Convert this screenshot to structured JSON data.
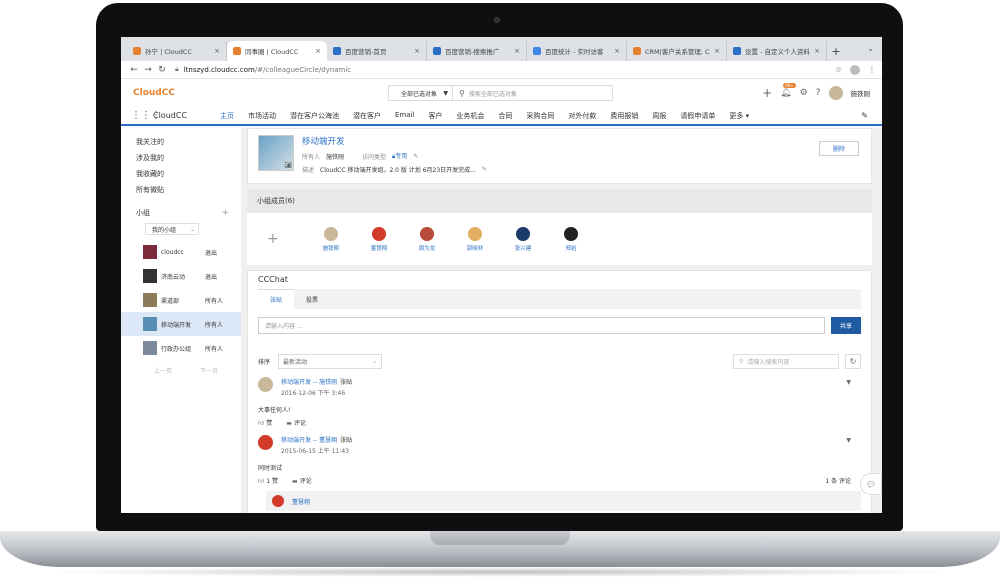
{
  "browser": {
    "tabs": [
      {
        "title": "孙宁 | CloudCC",
        "icon": "cloudcc-icon",
        "color": "#e8812f"
      },
      {
        "title": "同事圈 | CloudCC",
        "icon": "cloudcc-icon",
        "color": "#e8812f",
        "active": true
      },
      {
        "title": "百度营销-首页",
        "icon": "baidu-icon",
        "color": "#2b6fc4"
      },
      {
        "title": "百度营销-搜索推广",
        "icon": "baidu-icon",
        "color": "#2b6fc4"
      },
      {
        "title": "百度统计 - 实时访客",
        "icon": "baidu-stats-icon",
        "color": "#3f87e6"
      },
      {
        "title": "CRM|客户关系管理, C",
        "icon": "cloudcc-icon",
        "color": "#e8812f"
      },
      {
        "title": "设置 - 自定义个人资料",
        "icon": "gear-icon",
        "color": "#2b6fc4"
      }
    ],
    "url_host": "ltnszyd.cloudcc.com",
    "url_path": "/#/colleagueCircle/dynamic"
  },
  "header": {
    "logo": "CloudCC",
    "scope_select": "全部已选对象",
    "search_placeholder": "搜索全部已选对象",
    "notify_badge": "99+",
    "user_name": "施铁刚"
  },
  "nav": {
    "app_name": "CloudCC",
    "items": [
      "主页",
      "市场活动",
      "潜在客户公海池",
      "潜在客户",
      "Email",
      "客户",
      "业务机会",
      "合同",
      "采购合同",
      "对外付款",
      "费用报销",
      "周报",
      "请假申请单",
      "更多"
    ]
  },
  "sidebar": {
    "links": [
      "我关注的",
      "涉及我的",
      "我收藏的",
      "所有微贴"
    ],
    "groups_title": "小组",
    "my_groups": "我的小组",
    "groups": [
      {
        "name": "cloudcc",
        "action": "退出",
        "color": "#7a2a3a"
      },
      {
        "name": "济南云动",
        "action": "退出",
        "color": "#333333"
      },
      {
        "name": "渠道部",
        "action": "所有人",
        "color": "#8a7a5a"
      },
      {
        "name": "移动端开发",
        "action": "所有人",
        "color": "#5a8fb5"
      },
      {
        "name": "行政办公组",
        "action": "所有人",
        "color": "#7a8a9a"
      }
    ],
    "prev": "上一页",
    "next": "下一页"
  },
  "group": {
    "title": "移动端开发",
    "owner_label": "所有人",
    "owner": "施铁刚",
    "access_label": "访问类型",
    "access": "专用",
    "desc_label": "描述",
    "desc": "CloudCC 移动端开发组。2.0 版 计划 6月23日开发完成...",
    "delete": "删除"
  },
  "members": {
    "title": "小组成员(6)",
    "list": [
      {
        "name": "施铁刚",
        "color": "#c9b89a"
      },
      {
        "name": "董慧翔",
        "color": "#d23a2a"
      },
      {
        "name": "周为龙",
        "color": "#b84a3a"
      },
      {
        "name": "郭晓非",
        "color": "#e0b060"
      },
      {
        "name": "张兴建",
        "color": "#1a3a6a"
      },
      {
        "name": "郑岩",
        "color": "#222222"
      }
    ]
  },
  "chat": {
    "title": "CCChat",
    "tabs": [
      "张贴",
      "投票"
    ],
    "input_placeholder": "请输入内容 ...",
    "share": "共享",
    "sort_label": "排序",
    "sort_value": "最新活动",
    "search_placeholder": "请输入搜索内容",
    "posts": [
      {
        "link": "移动端开发 -- 施铁刚",
        "kind": "张贴",
        "time": "2016-12-06 下午 3:46",
        "text": "大事任何人!",
        "like": "赞",
        "comment": "评论",
        "count": "",
        "color": "#c9b89a"
      },
      {
        "link": "移动端开发 -- 董慧翔",
        "kind": "张贴",
        "time": "2015-06-15 上午 11:43",
        "text": "同时测试",
        "like": "1 赞",
        "comment": "评论",
        "count": "1 条 评论",
        "color": "#d23a2a"
      }
    ],
    "reply_name": "董慧翔"
  }
}
